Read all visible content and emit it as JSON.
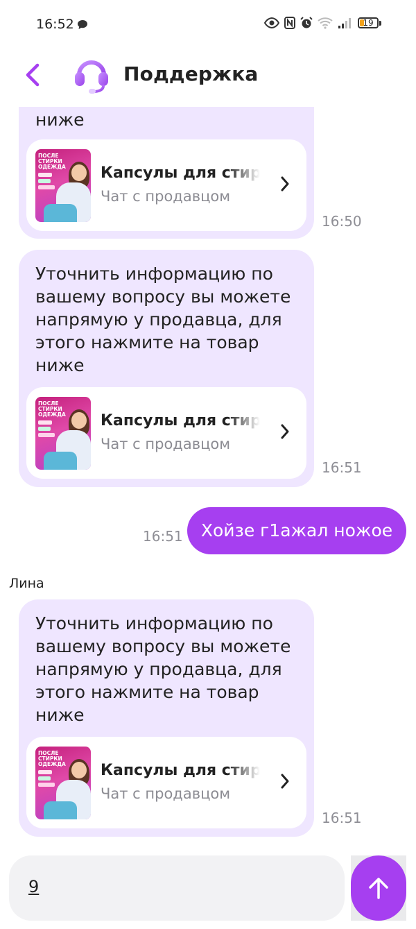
{
  "status": {
    "time": "16:52",
    "battery": "19"
  },
  "header": {
    "title": "Поддержка"
  },
  "messages": [
    {
      "text": "ниже",
      "product_title": "Капсулы для стирки",
      "product_sub": "Чат с продавцом",
      "time": "16:50"
    },
    {
      "text": "Уточнить информацию по вашему вопросу вы можете напрямую у продавца, для этого нажмите на товар ниже",
      "product_title": "Капсулы для стирки",
      "product_sub": "Чат с продавцом",
      "time": "16:51"
    },
    {
      "outgoing_text": "Хойзе г1ажал ножое",
      "time": "16:51"
    },
    {
      "sender": "Лина",
      "text": "Уточнить информацию по вашему вопросу вы можете напрямую у продавца, для этого нажмите на товар ниже",
      "product_title": "Капсулы для стирки",
      "product_sub": "Чат с продавцом",
      "time": "16:51"
    }
  ],
  "product_image_text": "ПОСЛЕ СТИРКИ ОДЕЖДА",
  "input": {
    "value": "9"
  },
  "colors": {
    "accent": "#a63ff0",
    "incoming_bubble": "#efe6ff"
  }
}
